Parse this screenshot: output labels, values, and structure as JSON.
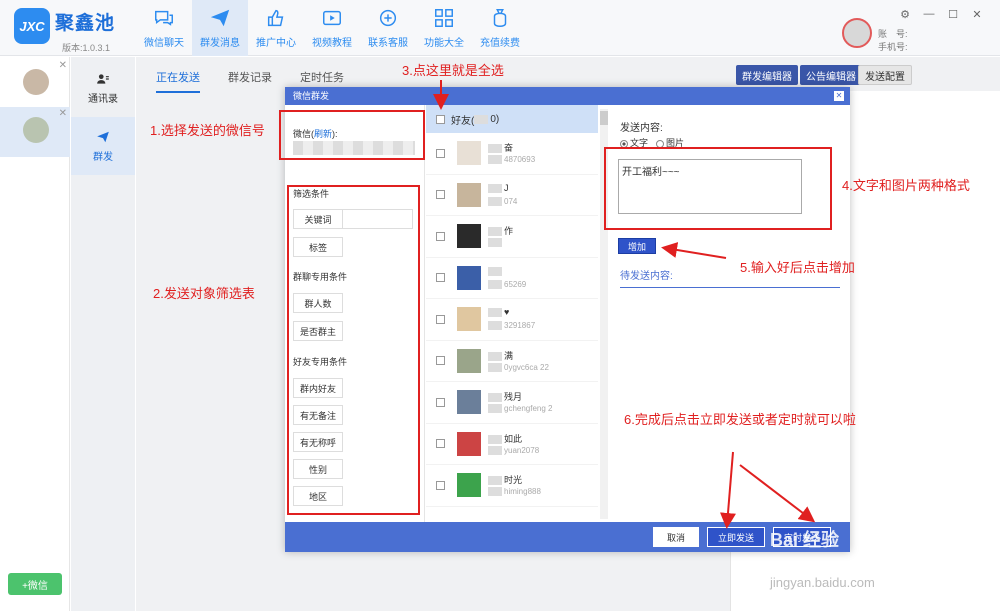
{
  "app": {
    "logo": "JXC",
    "name": "聚鑫池",
    "version": "版本:1.0.3.1"
  },
  "nav": [
    {
      "label": "微信聊天",
      "icon": "chat-icon"
    },
    {
      "label": "群发消息",
      "icon": "send-icon"
    },
    {
      "label": "推广中心",
      "icon": "thumbsup-icon"
    },
    {
      "label": "视频教程",
      "icon": "video-icon"
    },
    {
      "label": "联系客服",
      "icon": "support-icon"
    },
    {
      "label": "功能大全",
      "icon": "grid-icon"
    },
    {
      "label": "充值续费",
      "icon": "money-bag-icon"
    }
  ],
  "user": {
    "account_label": "账　号:",
    "phone_label": "手机号:"
  },
  "window_controls": {
    "settings": "⚙",
    "minimize": "—",
    "maximize": "☐",
    "close": "✕"
  },
  "sidebar2": {
    "contacts": "通讯录",
    "groupsend": "群发"
  },
  "add_wechat": "+微信",
  "tabs": [
    "正在发送",
    "群发记录",
    "定时任务"
  ],
  "top_buttons": {
    "group_editor": "群发编辑器",
    "notice_editor": "公告编辑器",
    "send_config": "发送配置"
  },
  "dialog": {
    "title": "微信群发",
    "wx_label_prefix": "微信(",
    "refresh": "刷新",
    "wx_label_suffix": "):",
    "filter_title": "筛选条件",
    "keyword": "关键词",
    "tag": "标签",
    "group_section": "群聊专用条件",
    "group_size": "群人数",
    "is_owner": "是否群主",
    "friend_section": "好友专用条件",
    "in_group": "群内好友",
    "has_note": "有无备注",
    "has_title": "有无称呼",
    "gender": "性别",
    "region": "地区",
    "friends_header": "好友(",
    "friends_header_suffix": "0)",
    "friends": [
      {
        "name": "奋",
        "id": "4870693"
      },
      {
        "name": "J",
        "id": "074"
      },
      {
        "name": "作",
        "id": ""
      },
      {
        "name": "",
        "id": "65269"
      },
      {
        "name": "♥",
        "id": "3291867"
      },
      {
        "name": "满",
        "id": "0ygvc6ca    22"
      },
      {
        "name": "残月",
        "id": "gchengfeng    2"
      },
      {
        "name": "如此",
        "id": "yuan2078"
      },
      {
        "name": "时光",
        "id": "himing888"
      }
    ],
    "send_content_label": "发送内容:",
    "radio_text": "文字",
    "radio_image": "图片",
    "message_text": "开工福利~~~",
    "add_button": "增加",
    "pending_label": "待发送内容:",
    "cancel": "取消",
    "send_now": "立即发送",
    "scheduled": "定时发送"
  },
  "annotations": {
    "a1": "1.选择发送的微信号",
    "a2": "2.发送对象筛选表",
    "a3": "3.点这里就是全选",
    "a4": "4.文字和图片两种格式",
    "a5": "5.输入好后点击增加",
    "a6": "6.完成后点击立即发送或者定时就可以啦"
  },
  "watermark": {
    "brand": "Bai 经验",
    "url": "jingyan.baidu.com"
  },
  "colors": {
    "accent": "#2d8cf0",
    "dialog_blue": "#4a6fd2",
    "annotation_red": "#e02020",
    "add_green": "#4cc36d"
  }
}
